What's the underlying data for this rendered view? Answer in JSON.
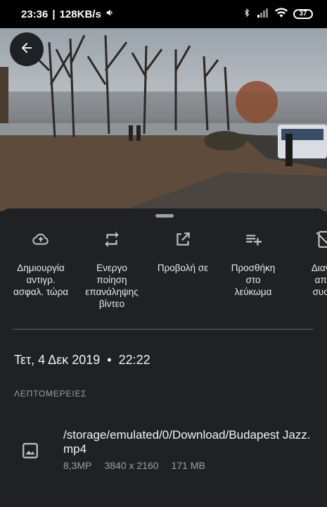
{
  "status_bar": {
    "time": "23:36",
    "separator": "|",
    "net_speed": "128KB/s",
    "battery": "37"
  },
  "actions": [
    {
      "icon": "cloud-upload-icon",
      "label": "Δημιουργία\nαντιγρ.\nασφαλ. τώρα"
    },
    {
      "icon": "repeat-icon",
      "label": "Ενεργο\nποίηση\nεπανάληψης\nβίντεο"
    },
    {
      "icon": "open-in-new-icon",
      "label": "Προβολή σε"
    },
    {
      "icon": "playlist-add-icon",
      "label": "Προσθήκη\nστο\nλεύκωμα"
    },
    {
      "icon": "delete-from-device-icon",
      "label": "Διαγρ\nαπό\nσυσκ"
    }
  ],
  "details": {
    "date": "Τετ, 4 Δεκ 2019",
    "bullet": "•",
    "time": "22:22",
    "section_label": "ΛΕΠΤΟΜΕΡΕΙΕΣ",
    "file_path": "/storage/emulated/0/Download/Budapest Jazz.mp4",
    "megapixels": "8,3MP",
    "resolution": "3840 x 2160",
    "size": "171 MB"
  }
}
